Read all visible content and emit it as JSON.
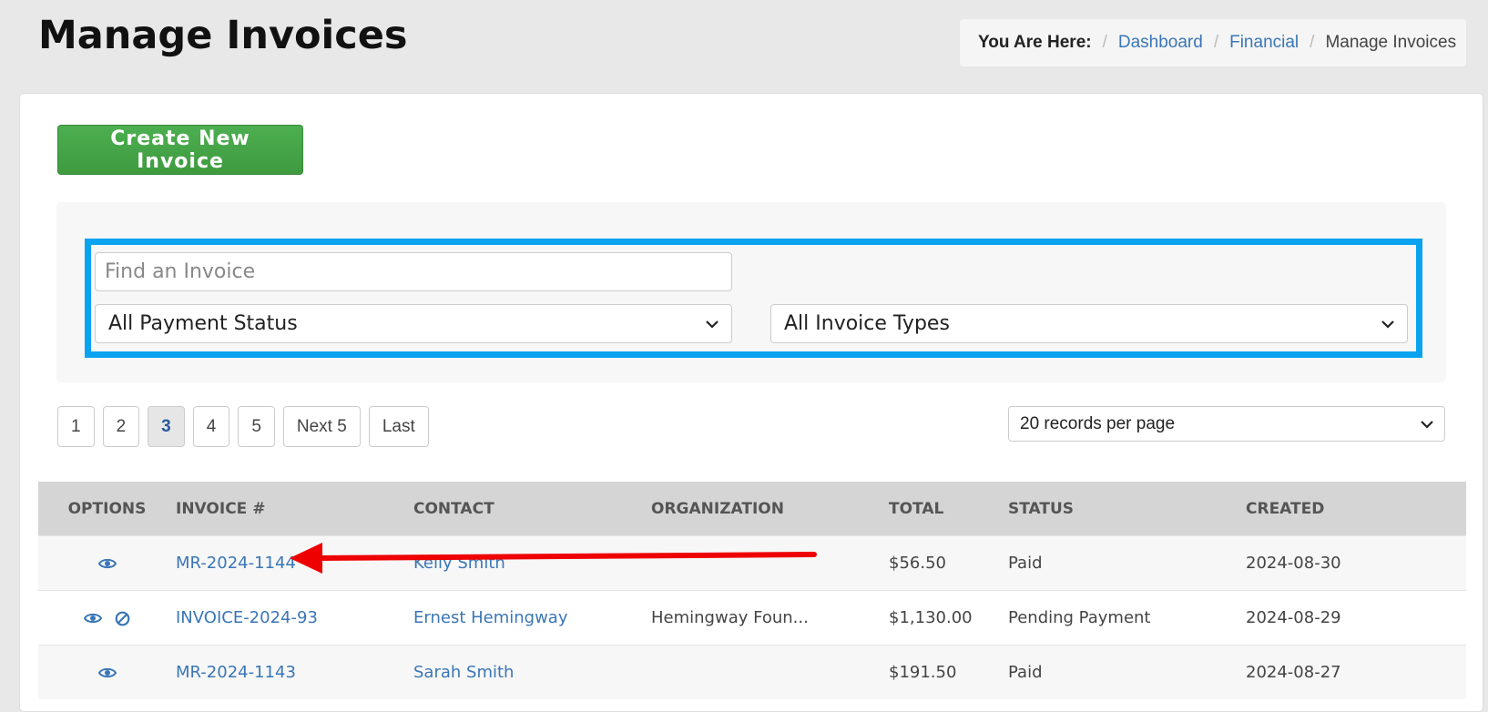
{
  "page": {
    "title": "Manage Invoices"
  },
  "breadcrumb": {
    "lead": "You Are Here:",
    "sep": "/",
    "items": [
      "Dashboard",
      "Financial"
    ],
    "current": "Manage Invoices"
  },
  "toolbar": {
    "create_label": "Create New Invoice"
  },
  "filters": {
    "search_placeholder": "Find an Invoice",
    "payment_status": "All Payment Status",
    "invoice_types": "All Invoice Types"
  },
  "pagination": {
    "pages": [
      "1",
      "2",
      "3",
      "4",
      "5"
    ],
    "active_page": "3",
    "next_label": "Next 5",
    "last_label": "Last",
    "per_page": "20 records per page"
  },
  "table": {
    "columns": [
      "OPTIONS",
      "INVOICE #",
      "CONTACT",
      "ORGANIZATION",
      "TOTAL",
      "STATUS",
      "CREATED"
    ],
    "rows": [
      {
        "invoice": "MR-2024-1144",
        "contact": "Kelly Smith",
        "organization": "",
        "total": "$56.50",
        "status": "Paid",
        "created": "2024-08-30"
      },
      {
        "invoice": "INVOICE-2024-93",
        "contact": "Ernest Hemingway",
        "organization": "Hemingway Foun...",
        "total": "$1,130.00",
        "status": "Pending Payment",
        "created": "2024-08-29"
      },
      {
        "invoice": "MR-2024-1143",
        "contact": "Sarah Smith",
        "organization": "",
        "total": "$191.50",
        "status": "Paid",
        "created": "2024-08-27"
      }
    ]
  },
  "colors": {
    "accent_blue": "#0aa3f0",
    "link": "#3a76b6",
    "create_green": "#4caf50",
    "annotation_red": "#ee0000"
  }
}
